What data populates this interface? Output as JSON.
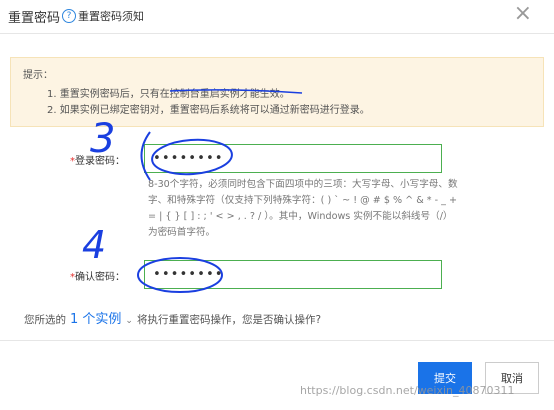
{
  "dialog": {
    "title": "重置密码",
    "help_link": "重置密码须知",
    "close_symbol": "×"
  },
  "tips": {
    "title": "提示：",
    "line1_a": "1. 重置实例密码后，只有",
    "line1_b": "在控制台重启",
    "line1_c": "实例才能生效。",
    "line2": "2. 如果实例已绑定密钥对，重置密码后系统将可以通过新密码进行登录。"
  },
  "form": {
    "login_label": "登录密码：",
    "login_value": "••••••••",
    "requirements": "8-30个字符，必须同时包含下面四项中的三项：大写字母、小写字母、数字、和特殊字符（仅支持下列特殊字符：( ) ` ~ ! @ # $ % ^ & * - _ + = | { } [ ] : ; ' < > , . ? / ）。其中，Windows 实例不能以斜线号（/）为密码首字符。",
    "confirm_label": "确认密码：",
    "confirm_value": "••••••••",
    "required_mark": "*"
  },
  "confirm": {
    "prefix": "您所选的",
    "count": "1 个实例",
    "chevron": "⌄",
    "suffix": "将执行重置密码操作，您是否确认操作?"
  },
  "buttons": {
    "submit": "提交",
    "cancel": "取消"
  },
  "annotations": {
    "step_login": "3",
    "step_confirm": "4"
  },
  "watermark": "https://blog.csdn.net/weixin_40870311",
  "colors": {
    "primary": "#1a73e8",
    "valid_border": "#4caf50",
    "required": "#e5312f",
    "tips_bg": "#fdf4e3",
    "annotation": "#1a3fe0"
  }
}
